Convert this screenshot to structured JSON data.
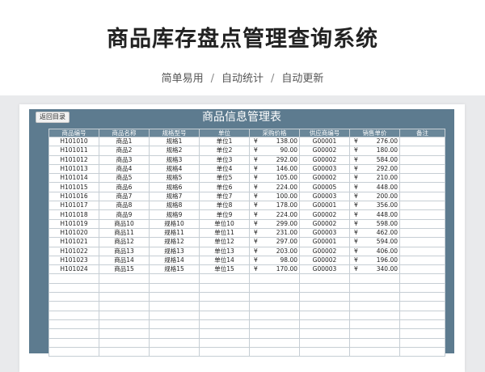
{
  "page": {
    "title": "商品库存盘点管理查询系统",
    "tags": [
      "简单易用",
      "自动统计",
      "自动更新"
    ],
    "separator": "/"
  },
  "sheet": {
    "back_button": "返回目录",
    "title": "商品信息管理表",
    "columns": [
      "商品编号",
      "商品名称",
      "规格型号",
      "单位",
      "采购价格",
      "供应商编号",
      "销售单价",
      "备注"
    ],
    "currency_symbol": "¥",
    "rows": [
      [
        "H101010",
        "商品1",
        "规格1",
        "单位1",
        "138.00",
        "G00001",
        "276.00",
        ""
      ],
      [
        "H101011",
        "商品2",
        "规格2",
        "单位2",
        "90.00",
        "G00002",
        "180.00",
        ""
      ],
      [
        "H101012",
        "商品3",
        "规格3",
        "单位3",
        "292.00",
        "G00002",
        "584.00",
        ""
      ],
      [
        "H101013",
        "商品4",
        "规格4",
        "单位4",
        "146.00",
        "G00003",
        "292.00",
        ""
      ],
      [
        "H101014",
        "商品5",
        "规格5",
        "单位5",
        "105.00",
        "G00002",
        "210.00",
        ""
      ],
      [
        "H101015",
        "商品6",
        "规格6",
        "单位6",
        "224.00",
        "G00005",
        "448.00",
        ""
      ],
      [
        "H101016",
        "商品7",
        "规格7",
        "单位7",
        "100.00",
        "G00003",
        "200.00",
        ""
      ],
      [
        "H101017",
        "商品8",
        "规格8",
        "单位8",
        "178.00",
        "G00001",
        "356.00",
        ""
      ],
      [
        "H101018",
        "商品9",
        "规格9",
        "单位9",
        "224.00",
        "G00002",
        "448.00",
        ""
      ],
      [
        "H101019",
        "商品10",
        "规格10",
        "单位10",
        "299.00",
        "G00002",
        "598.00",
        ""
      ],
      [
        "H101020",
        "商品11",
        "规格11",
        "单位11",
        "231.00",
        "G00003",
        "462.00",
        ""
      ],
      [
        "H101021",
        "商品12",
        "规格12",
        "单位12",
        "297.00",
        "G00001",
        "594.00",
        ""
      ],
      [
        "H101022",
        "商品13",
        "规格13",
        "单位13",
        "203.00",
        "G00002",
        "406.00",
        ""
      ],
      [
        "H101023",
        "商品14",
        "规格14",
        "单位14",
        "98.00",
        "G00002",
        "196.00",
        ""
      ],
      [
        "H101024",
        "商品15",
        "规格15",
        "单位15",
        "170.00",
        "G00003",
        "340.00",
        ""
      ]
    ],
    "blank_rows": 9
  }
}
